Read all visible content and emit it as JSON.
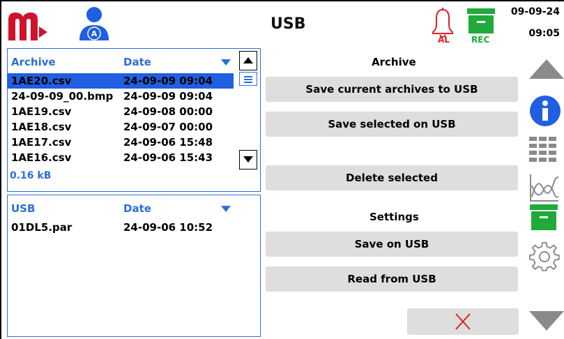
{
  "header": {
    "title": "USB",
    "alarm_label": "AL",
    "record_label": "REC",
    "date": "09-09-24",
    "time": "09:05",
    "user_badge": "A"
  },
  "archive_list": {
    "col_name": "Archive",
    "col_date": "Date",
    "rows": [
      {
        "name": "1AE20.csv",
        "date": "24-09-09 09:04",
        "selected": true
      },
      {
        "name": "24-09-09_00.bmp",
        "date": "24-09-09 09:04"
      },
      {
        "name": "1AE19.csv",
        "date": "24-09-08 00:00"
      },
      {
        "name": "1AE18.csv",
        "date": "24-09-07 00:00"
      },
      {
        "name": "1AE17.csv",
        "date": "24-09-06 15:48"
      },
      {
        "name": "1AE16.csv",
        "date": "24-09-06 15:43"
      }
    ],
    "size": "0.16 kB"
  },
  "usb_list": {
    "col_name": "USB",
    "col_date": "Date",
    "rows": [
      {
        "name": "01DL5.par",
        "date": "24-09-06 10:52"
      }
    ]
  },
  "actions": {
    "archive_heading": "Archive",
    "save_current": "Save current archives to USB",
    "save_selected": "Save selected on USB",
    "delete_selected": "Delete selected",
    "settings_heading": "Settings",
    "save_on_usb": "Save on USB",
    "read_from_usb": "Read from USB",
    "close_icon": "close-icon"
  },
  "colors": {
    "accent_blue": "#2b6fd6",
    "selection": "#1f5fe0",
    "alarm_red": "#e02020",
    "rec_green": "#1faa3a",
    "logo_red": "#d0122a",
    "button_gray": "#dedede",
    "icon_gray": "#8a8a8a"
  }
}
